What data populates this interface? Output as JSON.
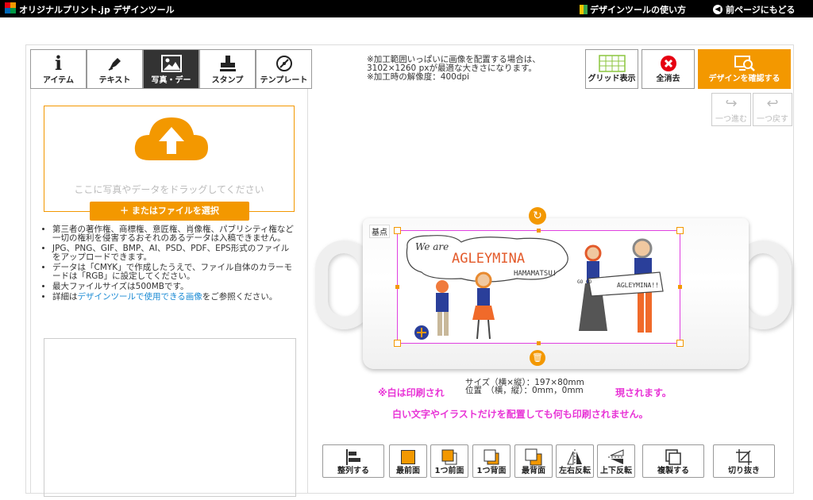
{
  "header": {
    "brand": "オリジナルプリント.jp デザインツール",
    "help_link": "デザインツールの使い方",
    "back_link": "前ページにもどる"
  },
  "tabs": [
    {
      "label": "アイテム",
      "icon": "info-icon"
    },
    {
      "label": "テキスト",
      "icon": "pen-icon"
    },
    {
      "label": "写真・デー",
      "icon": "image-icon",
      "active": true
    },
    {
      "label": "スタンプ",
      "icon": "stamp-icon"
    },
    {
      "label": "テンプレート",
      "icon": "template-icon"
    }
  ],
  "upload": {
    "drop_text": "ここに写真やデータをドラッグしてください",
    "select_button": "＋ またはファイルを選択"
  },
  "notes": {
    "item1": "第三者の著作権、商標権、意匠権、肖像権、パブリシティ権など一切の権利を侵害するおそれのあるデータは入稿できません。",
    "item2": "JPG、PNG、GIF、BMP、AI、PSD、PDF、EPS形式のファイルをアップロードできます。",
    "item3": "データは「CMYK」で作成したうえで、ファイル自体のカラーモードは「RGB」に設定してください。",
    "item4": "最大ファイルサイズは500MBです。",
    "item5_prefix": "詳細は",
    "item5_link": "デザインツールで使用できる画像",
    "item5_suffix": "をご参照ください。"
  },
  "info": {
    "line1": "※加工範囲いっぱいに画像を配置する場合は、",
    "line2": "3102×1260 pxが最適な大きさになります。",
    "line3": "※加工時の解像度：400dpi"
  },
  "right_buttons": {
    "grid": "グリッド表示",
    "clear": "全消去",
    "confirm": "デザインを確認する",
    "redo": "一つ進む",
    "undo": "一つ戻す"
  },
  "canvas": {
    "base_point": "基点",
    "size": "サイズ（横×縦）：197×80mm",
    "position": "位置　（横，縦）：0mm，0mm",
    "design_text_weare": "We are",
    "design_text_title": "AGLEYMINA",
    "design_text_sub": "HAMAMATSU!",
    "design_banner": "AGLEYMINA!!",
    "design_sign": "GO GO"
  },
  "warnings": {
    "line1_a": "※白は印刷され",
    "line1_b": "現されます。",
    "line2": "白い文字やイラストだけを配置しても何も印刷されません。"
  },
  "toolbar": [
    {
      "label": "整列する",
      "icon": "align-icon"
    },
    {
      "label": "最前面",
      "icon": "bring-front-icon"
    },
    {
      "label": "1つ前面",
      "icon": "bring-forward-icon"
    },
    {
      "label": "1つ背面",
      "icon": "send-backward-icon"
    },
    {
      "label": "最背面",
      "icon": "send-back-icon"
    },
    {
      "label": "左右反転",
      "icon": "flip-horizontal-icon"
    },
    {
      "label": "上下反転",
      "icon": "flip-vertical-icon"
    },
    {
      "label": "複製する",
      "icon": "duplicate-icon"
    },
    {
      "label": "切り抜き",
      "icon": "crop-icon"
    }
  ],
  "colors": {
    "accent": "#f39800",
    "warning": "#e834d6",
    "link": "#1a8ad4"
  }
}
